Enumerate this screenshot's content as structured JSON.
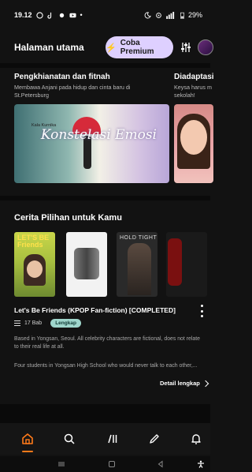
{
  "status_bar": {
    "time": "19.12",
    "battery": "29%"
  },
  "header": {
    "title": "Halaman utama",
    "premium_label": "Coba Premium"
  },
  "featured": {
    "items": [
      {
        "title": "Pengkhianatan dan fitnah",
        "description": "Membawa Anjani pada hidup dan cinta baru di St.Petersburg",
        "cover_title": "Konstelasi Emosi",
        "cover_author": "Kala Kurnika"
      },
      {
        "title": "Diadaptasi",
        "description": "Keysa harus m sekolah!"
      }
    ]
  },
  "picks": {
    "section_title": "Cerita Pilihan untuk Kamu",
    "covers": [
      {
        "cover_text": "LET'S BE Friends"
      },
      {
        "cover_text": ""
      },
      {
        "cover_text": "HOLD TIGHT"
      },
      {
        "cover_text": ""
      }
    ],
    "selected": {
      "title": "Let's Be Friends (KPOP Fan-fiction) [COMPLETED]",
      "chapters": "17 Bab",
      "status": "Lengkap",
      "description_1": "Based in Yongsan, Seoul. All celebrity characters are fictional, does not relate to their real life at all.",
      "description_2": "Four students in Yongsan High School who would never talk to each other,...",
      "detail_label": "Detail lengkap"
    }
  },
  "bottom_nav": {
    "items": [
      "home",
      "search",
      "library",
      "write",
      "notifications"
    ],
    "active": "home",
    "accent": "#ff7a1a"
  },
  "colors": {
    "background": "#121212",
    "premium_bg": "#ded0ff",
    "badge_bg": "#9fd6cc"
  }
}
